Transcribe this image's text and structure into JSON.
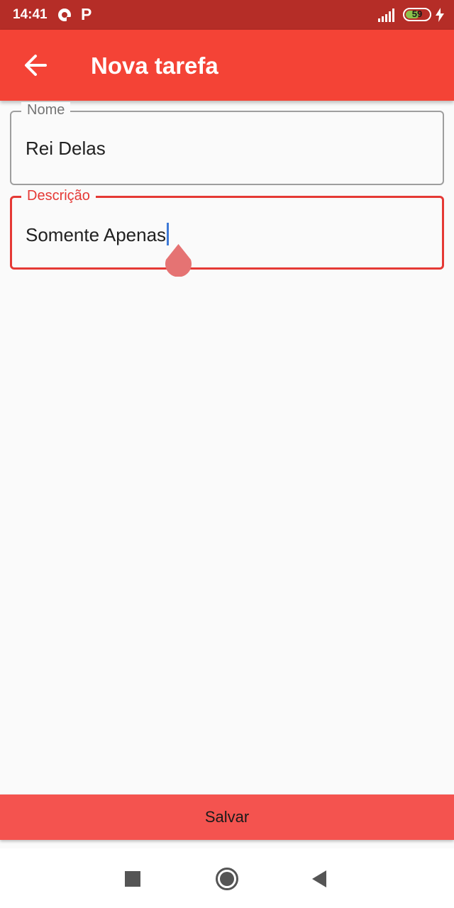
{
  "status_bar": {
    "time": "14:41",
    "app_letter": "P",
    "battery_level": "59",
    "battery_fill_fraction": 0.59
  },
  "app_bar": {
    "title": "Nova tarefa",
    "background_color": "#f44336",
    "back_icon": "arrow-left-icon"
  },
  "form": {
    "nome": {
      "label": "Nome",
      "value": "Rei Delas"
    },
    "descricao": {
      "label": "Descrição",
      "value": "Somente Apenas",
      "focused": true,
      "accent_color": "#e53935"
    }
  },
  "actions": {
    "save_label": "Salvar",
    "save_color": "#f4534f"
  },
  "nav_bar": {
    "recents_icon": "square-icon",
    "home_icon": "circle-icon",
    "back_icon": "triangle-back-icon"
  }
}
